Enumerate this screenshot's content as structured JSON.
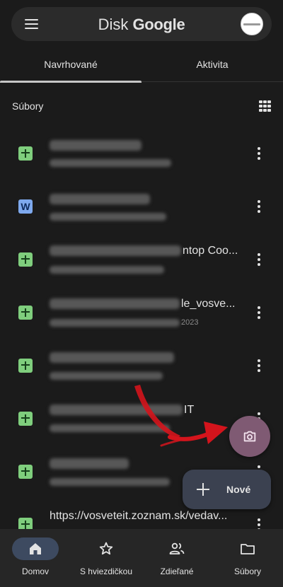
{
  "header": {
    "title_part1": "Disk ",
    "title_part2": "Google",
    "menu_icon": "hamburger-menu-icon",
    "avatar": "account-avatar"
  },
  "tabs": [
    {
      "label": "Navrhované",
      "selected": true
    },
    {
      "label": "Aktivita",
      "selected": false
    }
  ],
  "section": {
    "label": "Súbory",
    "view_icon": "grid-view-icon"
  },
  "files": [
    {
      "type": "sheet",
      "name_visible": "",
      "meta_visible": ""
    },
    {
      "type": "doc",
      "icon_letter": "W",
      "name_visible": "",
      "meta_visible": ""
    },
    {
      "type": "sheet",
      "name_visible": "ntop Coo...",
      "meta_visible": ""
    },
    {
      "type": "sheet",
      "name_visible": "le_vosve...",
      "meta_visible": "2023"
    },
    {
      "type": "sheet",
      "name_visible": "",
      "meta_visible": ""
    },
    {
      "type": "sheet",
      "name_visible": "IT",
      "meta_visible": ""
    },
    {
      "type": "sheet",
      "name_visible": "",
      "meta_visible": ""
    },
    {
      "type": "sheet",
      "name_visible": "https://vosveteit.zoznam.sk/vedav...",
      "meta_visible": ""
    }
  ],
  "fab": {
    "camera_icon": "camera-icon",
    "new_label": "Nové"
  },
  "bottom_nav": [
    {
      "label": "Domov",
      "icon": "home-icon",
      "selected": true
    },
    {
      "label": "S hviezdičkou",
      "icon": "star-icon",
      "selected": false
    },
    {
      "label": "Zdieľané",
      "icon": "people-icon",
      "selected": false
    },
    {
      "label": "Súbory",
      "icon": "folder-icon",
      "selected": false
    }
  ],
  "colors": {
    "background": "#1b1b1b",
    "sheet_icon": "#7fce7d",
    "doc_icon": "#7ea9ee",
    "camera_fab": "#7f5a73",
    "new_fab": "#3b4150",
    "nav_selected_pill": "#3d4a60",
    "annotation_arrow": "#d4141c"
  }
}
